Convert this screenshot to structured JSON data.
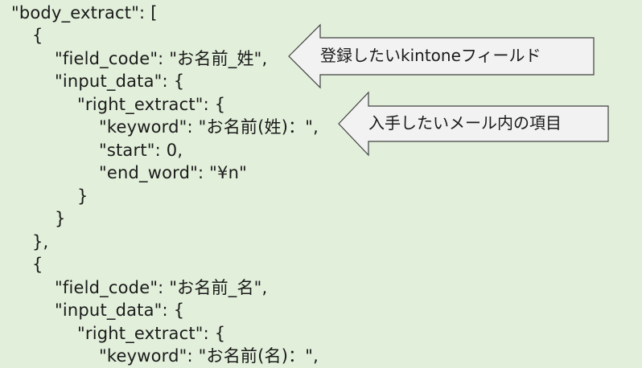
{
  "code_lines": [
    "\"body_extract\": [",
    "{",
    "\"field_code\": \"お名前_姓\",",
    "\"input_data\": {",
    "\"right_extract\": {",
    "\"keyword\": \"お名前(姓)：\",",
    "\"start\": 0,",
    "\"end_word\": \"¥n\"",
    "}",
    "}",
    "},",
    "{",
    "\"field_code\": \"お名前_名\",",
    "\"input_data\": {",
    "\"right_extract\": {",
    "\"keyword\": \"お名前(名)：\","
  ],
  "callouts": {
    "field": "登録したいkintoneフィールド",
    "keyword": "入手したいメール内の項目"
  },
  "colors": {
    "background": "#e2efda",
    "callout_fill": "#f2f2f2",
    "callout_border": "#404040"
  }
}
